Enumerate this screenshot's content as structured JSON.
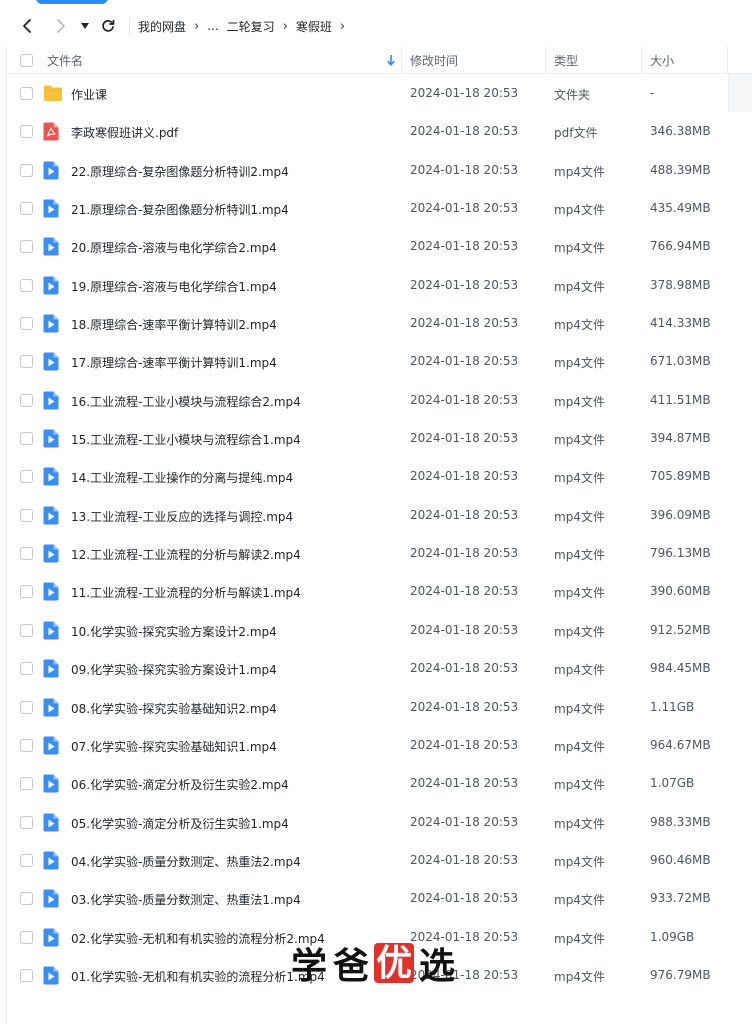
{
  "breadcrumb": [
    "我的网盘",
    "...",
    "二轮复习",
    "寒假班"
  ],
  "columns": {
    "name": "文件名",
    "modified": "修改时间",
    "type": "类型",
    "size": "大小"
  },
  "colors": {
    "folder": "#f7c23b",
    "pdf": "#ef5350",
    "video": "#3a8ef0",
    "accent": "#2a8cf5"
  },
  "files": [
    {
      "icon": "folder-icon",
      "name": "作业课",
      "modified": "2024-01-18 20:53",
      "type": "文件夹",
      "size": "-"
    },
    {
      "icon": "pdf-icon",
      "name": "李政寒假班讲义.pdf",
      "modified": "2024-01-18 20:53",
      "type": "pdf文件",
      "size": "346.38MB"
    },
    {
      "icon": "video-icon",
      "name": "22.原理综合-复杂图像题分析特训2.mp4",
      "modified": "2024-01-18 20:53",
      "type": "mp4文件",
      "size": "488.39MB"
    },
    {
      "icon": "video-icon",
      "name": "21.原理综合-复杂图像题分析特训1.mp4",
      "modified": "2024-01-18 20:53",
      "type": "mp4文件",
      "size": "435.49MB"
    },
    {
      "icon": "video-icon",
      "name": "20.原理综合-溶液与电化学综合2.mp4",
      "modified": "2024-01-18 20:53",
      "type": "mp4文件",
      "size": "766.94MB"
    },
    {
      "icon": "video-icon",
      "name": "19.原理综合-溶液与电化学综合1.mp4",
      "modified": "2024-01-18 20:53",
      "type": "mp4文件",
      "size": "378.98MB"
    },
    {
      "icon": "video-icon",
      "name": "18.原理综合-速率平衡计算特训2.mp4",
      "modified": "2024-01-18 20:53",
      "type": "mp4文件",
      "size": "414.33MB"
    },
    {
      "icon": "video-icon",
      "name": "17.原理综合-速率平衡计算特训1.mp4",
      "modified": "2024-01-18 20:53",
      "type": "mp4文件",
      "size": "671.03MB"
    },
    {
      "icon": "video-icon",
      "name": "16.工业流程-工业小模块与流程综合2.mp4",
      "modified": "2024-01-18 20:53",
      "type": "mp4文件",
      "size": "411.51MB"
    },
    {
      "icon": "video-icon",
      "name": "15.工业流程-工业小模块与流程综合1.mp4",
      "modified": "2024-01-18 20:53",
      "type": "mp4文件",
      "size": "394.87MB"
    },
    {
      "icon": "video-icon",
      "name": "14.工业流程-工业操作的分离与提纯.mp4",
      "modified": "2024-01-18 20:53",
      "type": "mp4文件",
      "size": "705.89MB"
    },
    {
      "icon": "video-icon",
      "name": "13.工业流程-工业反应的选择与调控.mp4",
      "modified": "2024-01-18 20:53",
      "type": "mp4文件",
      "size": "396.09MB"
    },
    {
      "icon": "video-icon",
      "name": "12.工业流程-工业流程的分析与解读2.mp4",
      "modified": "2024-01-18 20:53",
      "type": "mp4文件",
      "size": "796.13MB"
    },
    {
      "icon": "video-icon",
      "name": "11.工业流程-工业流程的分析与解读1.mp4",
      "modified": "2024-01-18 20:53",
      "type": "mp4文件",
      "size": "390.60MB"
    },
    {
      "icon": "video-icon",
      "name": "10.化学实验-探究实验方案设计2.mp4",
      "modified": "2024-01-18 20:53",
      "type": "mp4文件",
      "size": "912.52MB"
    },
    {
      "icon": "video-icon",
      "name": "09.化学实验-探究实验方案设计1.mp4",
      "modified": "2024-01-18 20:53",
      "type": "mp4文件",
      "size": "984.45MB"
    },
    {
      "icon": "video-icon",
      "name": "08.化学实验-探究实验基础知识2.mp4",
      "modified": "2024-01-18 20:53",
      "type": "mp4文件",
      "size": "1.11GB"
    },
    {
      "icon": "video-icon",
      "name": "07.化学实验-探究实验基础知识1.mp4",
      "modified": "2024-01-18 20:53",
      "type": "mp4文件",
      "size": "964.67MB"
    },
    {
      "icon": "video-icon",
      "name": "06.化学实验-滴定分析及衍生实验2.mp4",
      "modified": "2024-01-18 20:53",
      "type": "mp4文件",
      "size": "1.07GB"
    },
    {
      "icon": "video-icon",
      "name": "05.化学实验-滴定分析及衍生实验1.mp4",
      "modified": "2024-01-18 20:53",
      "type": "mp4文件",
      "size": "988.33MB"
    },
    {
      "icon": "video-icon",
      "name": "04.化学实验-质量分数测定、热重法2.mp4",
      "modified": "2024-01-18 20:53",
      "type": "mp4文件",
      "size": "960.46MB"
    },
    {
      "icon": "video-icon",
      "name": "03.化学实验-质量分数测定、热重法1.mp4",
      "modified": "2024-01-18 20:53",
      "type": "mp4文件",
      "size": "933.72MB"
    },
    {
      "icon": "video-icon",
      "name": "02.化学实验-无机和有机实验的流程分析2.mp4",
      "modified": "2024-01-18 20:53",
      "type": "mp4文件",
      "size": "1.09GB"
    },
    {
      "icon": "video-icon",
      "name": "01.化学实验-无机和有机实验的流程分析1.mp4",
      "modified": "2024-01-18 20:53",
      "type": "mp4文件",
      "size": "976.79MB"
    }
  ],
  "watermark": [
    "学",
    "爸",
    "优",
    "选"
  ]
}
